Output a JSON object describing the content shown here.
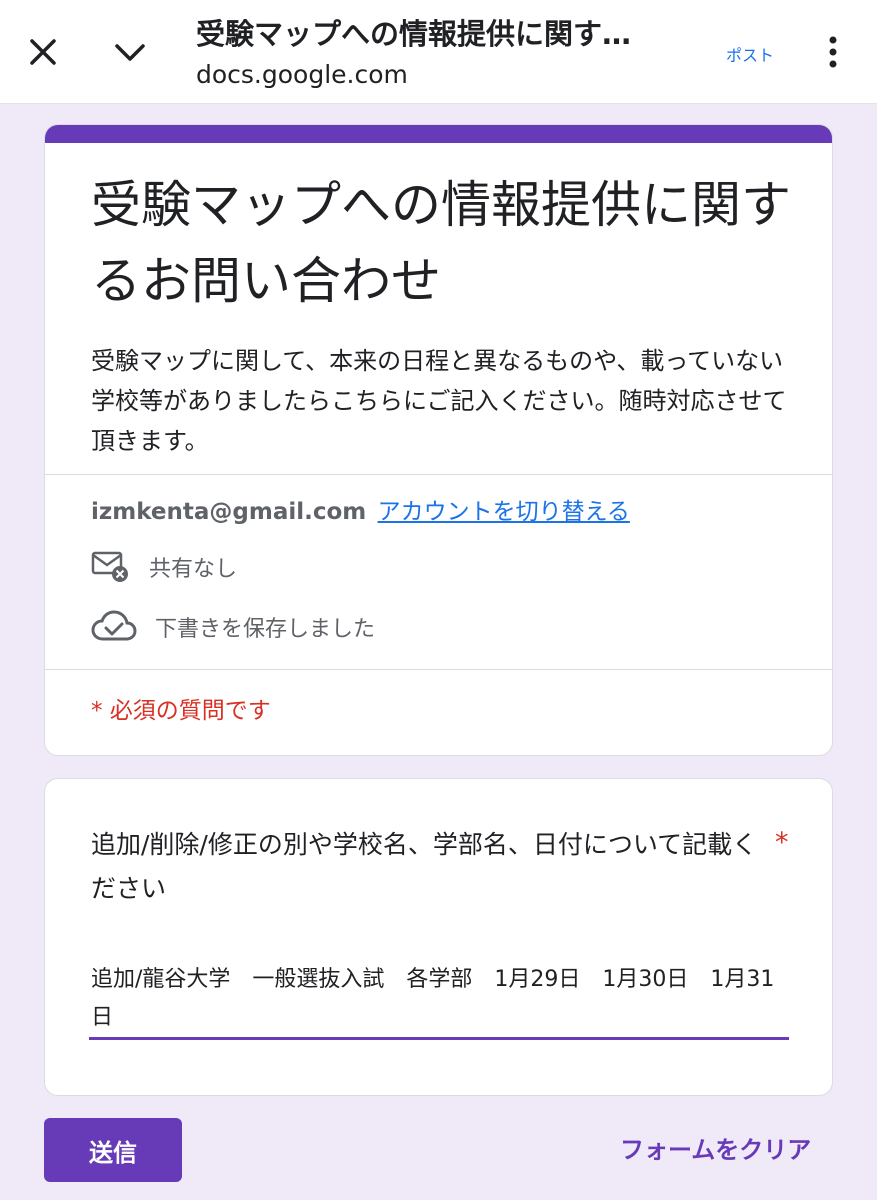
{
  "browser": {
    "title": "受験マップへの情報提供に関す…",
    "url": "docs.google.com",
    "post_label": "ポスト"
  },
  "form": {
    "title": "受験マップへの情報提供に関するお問い合わせ",
    "description": "受験マップに関して、本来の日程と異なるものや、載っていない学校等がありましたらこちらにご記入ください。随時対応させて頂きます。",
    "account_email": "izmkenta@gmail.com",
    "switch_account": "アカウントを切り替える",
    "sharing_status": "共有なし",
    "draft_status": "下書きを保存しました",
    "required_note": "* 必須の質問です"
  },
  "question": {
    "label": "追加/削除/修正の別や学校名、学部名、日付について記載ください",
    "required_mark": "*",
    "answer": "追加/龍谷大学　一般選抜入試　各学部　1月29日　1月30日　1月31日"
  },
  "actions": {
    "submit": "送信",
    "clear": "フォームをクリア"
  },
  "colors": {
    "accent": "#673ab7",
    "link": "#1a73e8",
    "required": "#d93025",
    "background": "#efe9f8"
  }
}
